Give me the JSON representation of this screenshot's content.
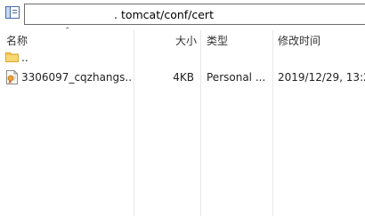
{
  "address": {
    "redacted": "· · ·",
    "path": ". tomcat/conf/cert"
  },
  "columns": {
    "name": "名称",
    "size": "大小",
    "type": "类型",
    "modified": "修改时间"
  },
  "rows": [
    {
      "icon": "folder-icon",
      "name": "..",
      "size": "",
      "type": "",
      "modified": ""
    },
    {
      "icon": "certificate-icon",
      "name": "3306097_cqzhangs....",
      "size": "4KB",
      "type": "Personal ...",
      "modified": "2019/12/29, 13:2"
    }
  ],
  "colors": {
    "folder": "#f0c850",
    "header_text": "#333333",
    "divider": "#e8e8e8"
  }
}
